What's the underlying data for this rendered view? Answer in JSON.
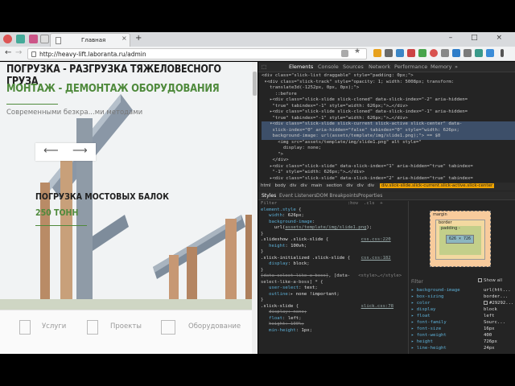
{
  "browser": {
    "tab_title": "Главная",
    "url": "http://heavy-lift.laboranta.ru/admin",
    "new_tab": "+",
    "close_tab": "×",
    "window_controls": "– □ ×",
    "back": "←",
    "forward": "→",
    "star": "★"
  },
  "page": {
    "title_1": "ПОГРУЗКА - РАЗГРУЗКА ТЯЖЕЛОВЕСНОГО ГРУЗА",
    "title_2": "МОНТАЖ - ДЕМОНТАЖ ОБОРУДОВАНИЯ",
    "subtitle": "Современными безкра...ми методами",
    "slider_prev": "⟵",
    "slider_next": "⟶",
    "caption_1": "ПОГРУЗКА МОСТОВЫХ БАЛОК",
    "caption_2": "250 ТОНН",
    "bottom": [
      "Услуги",
      "Проекты",
      "Оборудование"
    ]
  },
  "devtools": {
    "tabs": [
      "Elements",
      "Console",
      "Sources",
      "Network",
      "Performance",
      "Memory",
      "»"
    ],
    "active_tab": "Elements",
    "dom_lines": [
      "<div class=\"slick-list draggable\" style=\"padding: 0px;\">",
      " ▾<div class=\"slick-track\" style=\"opacity: 1; width: 5008px; transform:",
      "   translate3d(-1252px, 0px, 0px);\">",
      "     ::before",
      "   ▸<div class=\"slick-slide slick-cloned\" data-slick-index=\"-2\" aria-hidden=",
      "    \"true\" tabindex=\"-1\" style=\"width: 626px;\">…</div>",
      "   ▸<div class=\"slick-slide slick-cloned\" data-slick-index=\"-1\" aria-hidden=",
      "    \"true\" tabindex=\"-1\" style=\"width: 626px;\">…</div>",
      "   ▾<div class=\"slick-slide slick-current slick-active slick-center\" data-",
      "    slick-index=\"0\" aria-hidden=\"false\" tabindex=\"0\" style=\"width: 626px;",
      "    background-image: url(assets/template/img/slide1.png);\"> == $0",
      "      <img src=\"assets/template/img/slide1.png\" alt style=\"",
      "        display: none;",
      "      \">",
      "    </div>",
      "   ▸<div class=\"slick-slide\" data-slick-index=\"1\" aria-hidden=\"true\" tabindex=",
      "    \"-1\" style=\"width: 626px;\">…</div>",
      "   ▸<div class=\"slick-slide\" data-slick-index=\"2\" aria-hidden=\"true\" tabindex=",
      "    \"-1\" style=\"width: 626px;\">…</div>",
      "   ▸<div class=\"slick-slide\" data-slick-index=\"3\" aria-hidden=\"true\" tabindex="
    ],
    "breadcrumbs": [
      "html",
      "body",
      "div",
      "div",
      "main",
      "section",
      "div",
      "div",
      "div"
    ],
    "breadcrumb_selected": "div.slick-slide.slick-current.slick-active.slick-center",
    "subtabs": [
      "Styles",
      "Event Listeners",
      "DOM Breakpoints",
      "Properties"
    ],
    "styles_filter": "Filter",
    "styles_hov": ":hov  .cls  +",
    "computed_filter": "Filter",
    "show_all": "Show all",
    "box": {
      "margin": "margin",
      "border": "border",
      "padding": "padding -",
      "content": "626 × 726",
      "dash": "-"
    },
    "computed": [
      {
        "k": "background-image",
        "v": "url(htt..."
      },
      {
        "k": "box-sizing",
        "v": "border..."
      },
      {
        "k": "color",
        "v": "#29292..."
      },
      {
        "k": "display",
        "v": "block"
      },
      {
        "k": "float",
        "v": "left"
      },
      {
        "k": "font-family",
        "v": "Sourc..."
      },
      {
        "k": "font-size",
        "v": "16px"
      },
      {
        "k": "font-weight",
        "v": "400"
      },
      {
        "k": "height",
        "v": "726px"
      },
      {
        "k": "line-height",
        "v": "24px"
      }
    ],
    "color_swatch": "#292929"
  }
}
